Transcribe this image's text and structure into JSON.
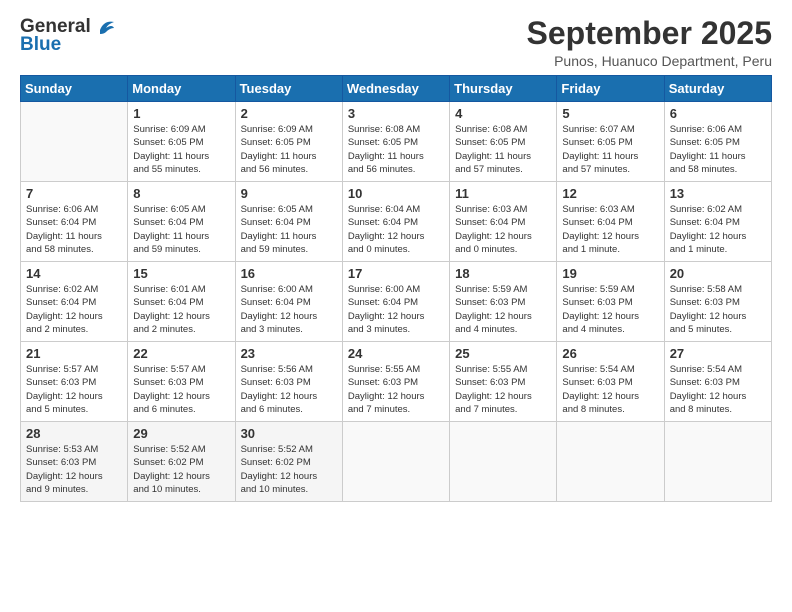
{
  "logo": {
    "line1": "General",
    "line2": "Blue"
  },
  "title": "September 2025",
  "subtitle": "Punos, Huanuco Department, Peru",
  "days_header": [
    "Sunday",
    "Monday",
    "Tuesday",
    "Wednesday",
    "Thursday",
    "Friday",
    "Saturday"
  ],
  "weeks": [
    [
      {
        "day": "",
        "info": ""
      },
      {
        "day": "1",
        "info": "Sunrise: 6:09 AM\nSunset: 6:05 PM\nDaylight: 11 hours\nand 55 minutes."
      },
      {
        "day": "2",
        "info": "Sunrise: 6:09 AM\nSunset: 6:05 PM\nDaylight: 11 hours\nand 56 minutes."
      },
      {
        "day": "3",
        "info": "Sunrise: 6:08 AM\nSunset: 6:05 PM\nDaylight: 11 hours\nand 56 minutes."
      },
      {
        "day": "4",
        "info": "Sunrise: 6:08 AM\nSunset: 6:05 PM\nDaylight: 11 hours\nand 57 minutes."
      },
      {
        "day": "5",
        "info": "Sunrise: 6:07 AM\nSunset: 6:05 PM\nDaylight: 11 hours\nand 57 minutes."
      },
      {
        "day": "6",
        "info": "Sunrise: 6:06 AM\nSunset: 6:05 PM\nDaylight: 11 hours\nand 58 minutes."
      }
    ],
    [
      {
        "day": "7",
        "info": "Sunrise: 6:06 AM\nSunset: 6:04 PM\nDaylight: 11 hours\nand 58 minutes."
      },
      {
        "day": "8",
        "info": "Sunrise: 6:05 AM\nSunset: 6:04 PM\nDaylight: 11 hours\nand 59 minutes."
      },
      {
        "day": "9",
        "info": "Sunrise: 6:05 AM\nSunset: 6:04 PM\nDaylight: 11 hours\nand 59 minutes."
      },
      {
        "day": "10",
        "info": "Sunrise: 6:04 AM\nSunset: 6:04 PM\nDaylight: 12 hours\nand 0 minutes."
      },
      {
        "day": "11",
        "info": "Sunrise: 6:03 AM\nSunset: 6:04 PM\nDaylight: 12 hours\nand 0 minutes."
      },
      {
        "day": "12",
        "info": "Sunrise: 6:03 AM\nSunset: 6:04 PM\nDaylight: 12 hours\nand 1 minute."
      },
      {
        "day": "13",
        "info": "Sunrise: 6:02 AM\nSunset: 6:04 PM\nDaylight: 12 hours\nand 1 minute."
      }
    ],
    [
      {
        "day": "14",
        "info": "Sunrise: 6:02 AM\nSunset: 6:04 PM\nDaylight: 12 hours\nand 2 minutes."
      },
      {
        "day": "15",
        "info": "Sunrise: 6:01 AM\nSunset: 6:04 PM\nDaylight: 12 hours\nand 2 minutes."
      },
      {
        "day": "16",
        "info": "Sunrise: 6:00 AM\nSunset: 6:04 PM\nDaylight: 12 hours\nand 3 minutes."
      },
      {
        "day": "17",
        "info": "Sunrise: 6:00 AM\nSunset: 6:04 PM\nDaylight: 12 hours\nand 3 minutes."
      },
      {
        "day": "18",
        "info": "Sunrise: 5:59 AM\nSunset: 6:03 PM\nDaylight: 12 hours\nand 4 minutes."
      },
      {
        "day": "19",
        "info": "Sunrise: 5:59 AM\nSunset: 6:03 PM\nDaylight: 12 hours\nand 4 minutes."
      },
      {
        "day": "20",
        "info": "Sunrise: 5:58 AM\nSunset: 6:03 PM\nDaylight: 12 hours\nand 5 minutes."
      }
    ],
    [
      {
        "day": "21",
        "info": "Sunrise: 5:57 AM\nSunset: 6:03 PM\nDaylight: 12 hours\nand 5 minutes."
      },
      {
        "day": "22",
        "info": "Sunrise: 5:57 AM\nSunset: 6:03 PM\nDaylight: 12 hours\nand 6 minutes."
      },
      {
        "day": "23",
        "info": "Sunrise: 5:56 AM\nSunset: 6:03 PM\nDaylight: 12 hours\nand 6 minutes."
      },
      {
        "day": "24",
        "info": "Sunrise: 5:55 AM\nSunset: 6:03 PM\nDaylight: 12 hours\nand 7 minutes."
      },
      {
        "day": "25",
        "info": "Sunrise: 5:55 AM\nSunset: 6:03 PM\nDaylight: 12 hours\nand 7 minutes."
      },
      {
        "day": "26",
        "info": "Sunrise: 5:54 AM\nSunset: 6:03 PM\nDaylight: 12 hours\nand 8 minutes."
      },
      {
        "day": "27",
        "info": "Sunrise: 5:54 AM\nSunset: 6:03 PM\nDaylight: 12 hours\nand 8 minutes."
      }
    ],
    [
      {
        "day": "28",
        "info": "Sunrise: 5:53 AM\nSunset: 6:03 PM\nDaylight: 12 hours\nand 9 minutes."
      },
      {
        "day": "29",
        "info": "Sunrise: 5:52 AM\nSunset: 6:02 PM\nDaylight: 12 hours\nand 10 minutes."
      },
      {
        "day": "30",
        "info": "Sunrise: 5:52 AM\nSunset: 6:02 PM\nDaylight: 12 hours\nand 10 minutes."
      },
      {
        "day": "",
        "info": ""
      },
      {
        "day": "",
        "info": ""
      },
      {
        "day": "",
        "info": ""
      },
      {
        "day": "",
        "info": ""
      }
    ]
  ]
}
